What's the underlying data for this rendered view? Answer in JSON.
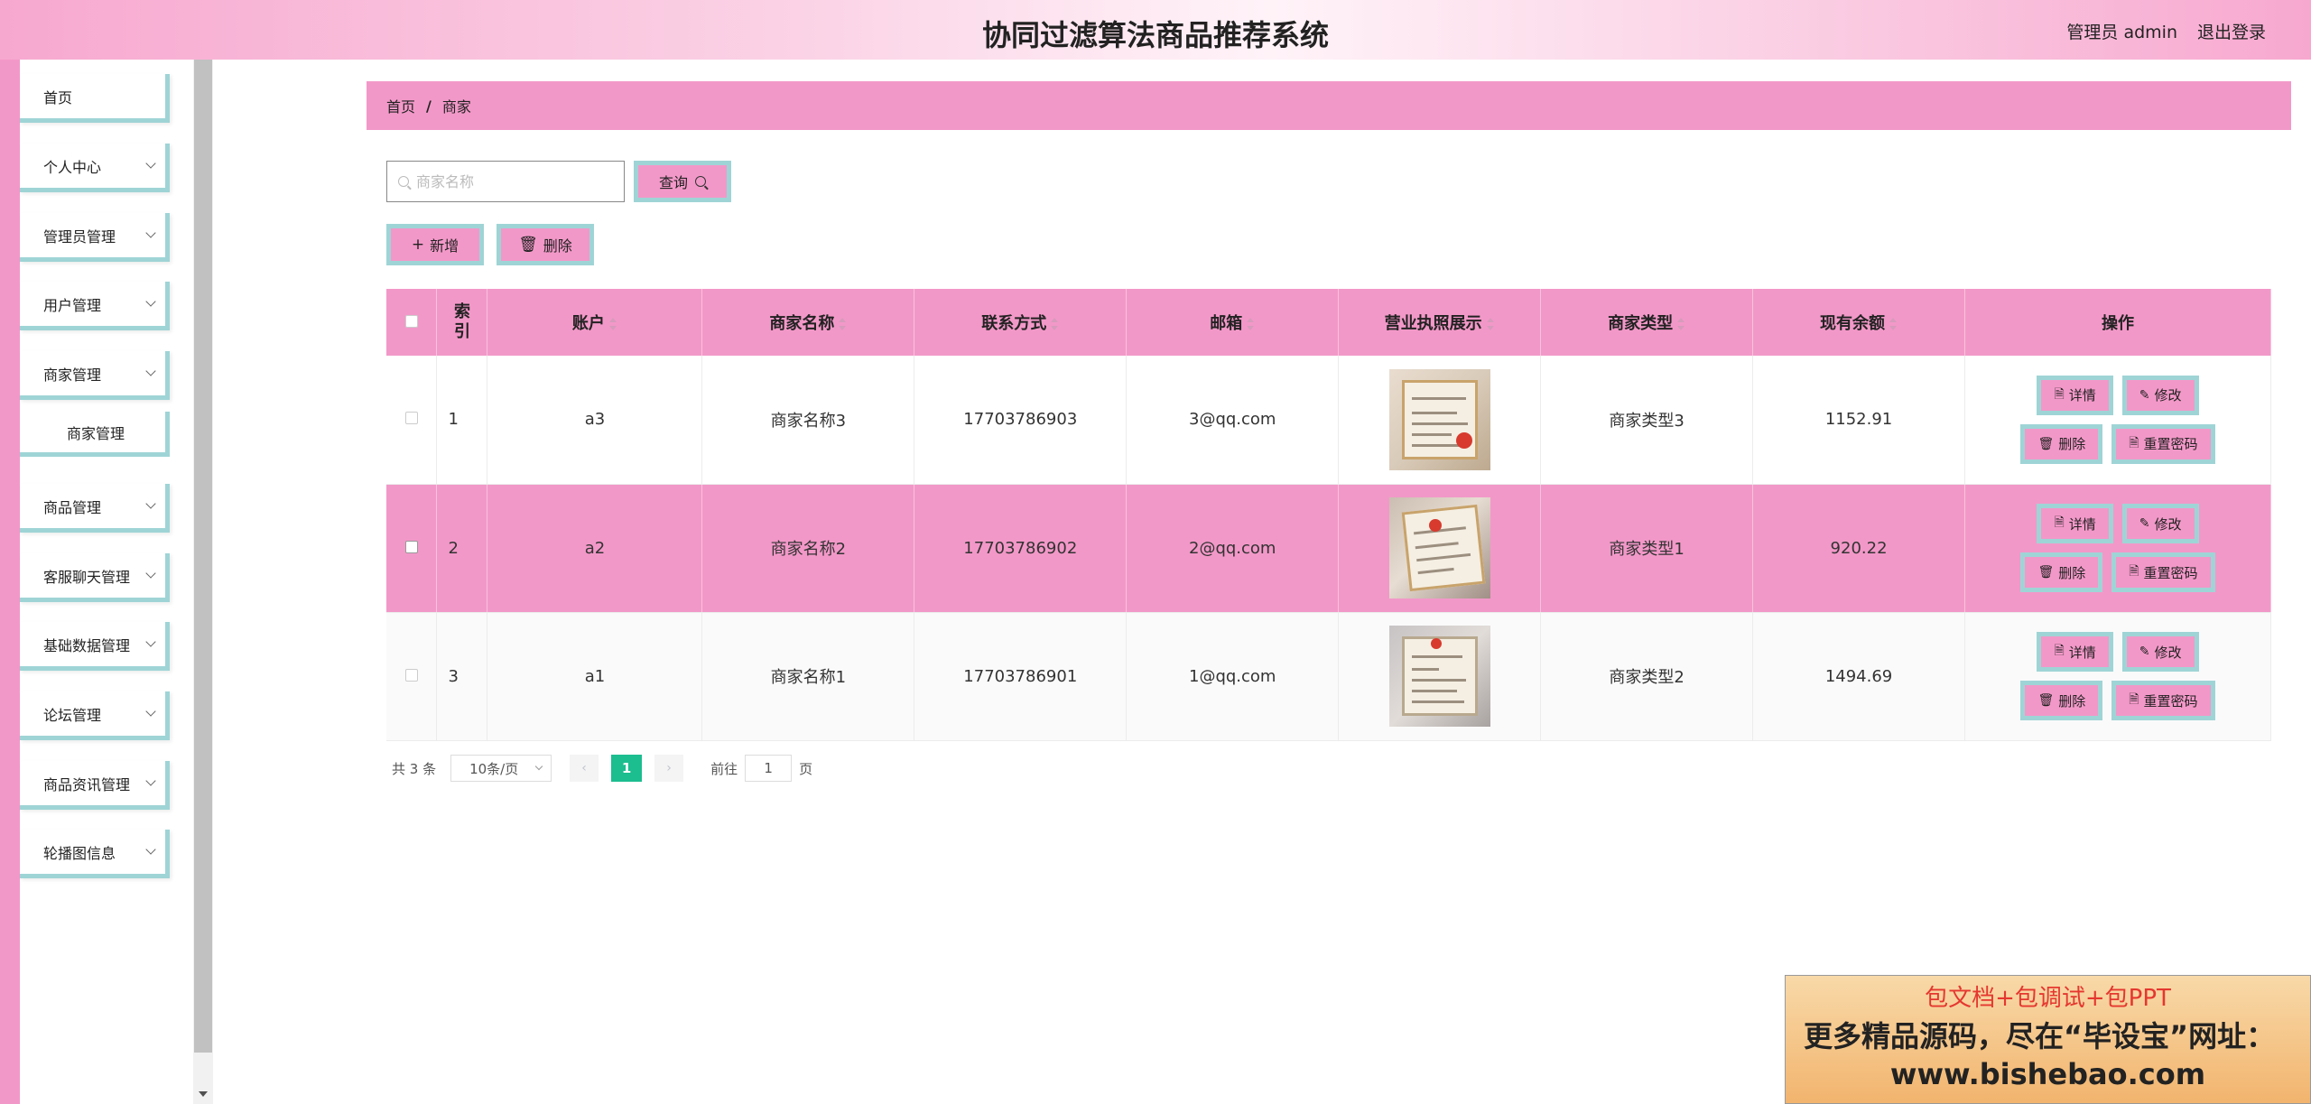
{
  "header": {
    "title": "协同过滤算法商品推荐系统",
    "user": "管理员 admin",
    "logout": "退出登录"
  },
  "sidebar": {
    "items": [
      {
        "label": "首页"
      },
      {
        "label": "个人中心"
      },
      {
        "label": "管理员管理"
      },
      {
        "label": "用户管理"
      },
      {
        "label": "商家管理"
      },
      {
        "label": "商家管理"
      },
      {
        "label": "商品管理"
      },
      {
        "label": "客服聊天管理"
      },
      {
        "label": "基础数据管理"
      },
      {
        "label": "论坛管理"
      },
      {
        "label": "商品资讯管理"
      },
      {
        "label": "轮播图信息"
      }
    ]
  },
  "breadcrumb": {
    "home": "首页",
    "separator": "/",
    "current": "商家"
  },
  "search": {
    "placeholder": "商家名称",
    "button": "查询"
  },
  "toolbar": {
    "add": "新增",
    "delete": "删除"
  },
  "table": {
    "columns": [
      "索引",
      "账户",
      "商家名称",
      "联系方式",
      "邮箱",
      "营业执照展示",
      "商家类型",
      "现有余额",
      "操作"
    ],
    "rows": [
      {
        "index": "1",
        "account": "a3",
        "name": "商家名称3",
        "phone": "17703786903",
        "email": "3@qq.com",
        "type": "商家类型3",
        "balance": "1152.91"
      },
      {
        "index": "2",
        "account": "a2",
        "name": "商家名称2",
        "phone": "17703786902",
        "email": "2@qq.com",
        "type": "商家类型1",
        "balance": "920.22"
      },
      {
        "index": "3",
        "account": "a1",
        "name": "商家名称1",
        "phone": "17703786901",
        "email": "1@qq.com",
        "type": "商家类型2",
        "balance": "1494.69"
      }
    ],
    "actions": {
      "detail": "详情",
      "edit": "修改",
      "delete": "删除",
      "reset": "重置密码"
    }
  },
  "pagination": {
    "total": "共 3 条",
    "page_size": "10条/页",
    "current_page": "1",
    "goto_prefix": "前往",
    "goto_value": "1",
    "goto_suffix": "页"
  },
  "ad": {
    "line1": "包文档+包调试+包PPT",
    "line2": "更多精品源码，尽在“毕设宝”网址：",
    "line3": "www.bishebao.com"
  },
  "colors": {
    "accent_pink": "#f298c8",
    "border_teal": "#9fd4d6",
    "page_active": "#1cbd8f"
  }
}
